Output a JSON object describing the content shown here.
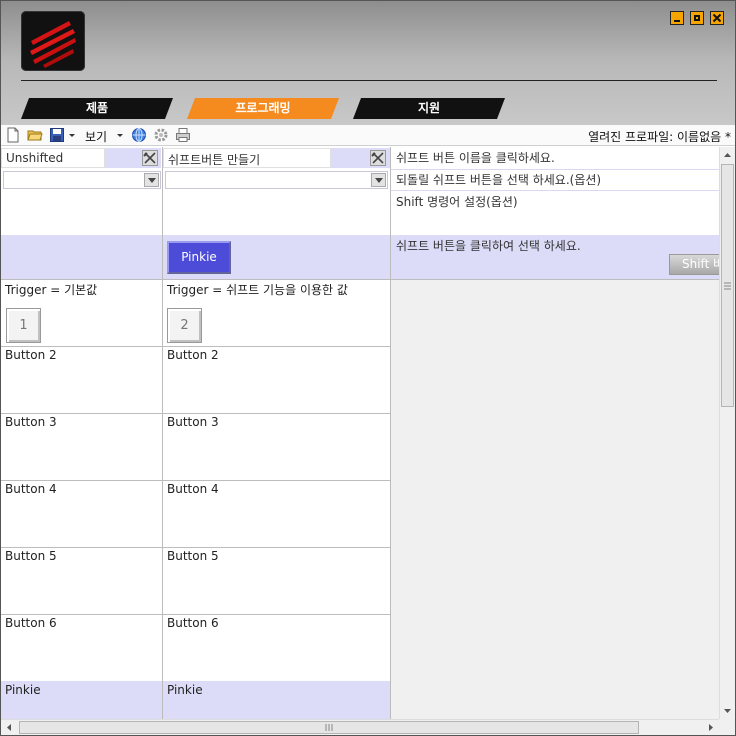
{
  "window": {
    "controls": [
      "minimize",
      "restore",
      "close"
    ]
  },
  "tabs": [
    {
      "label": "제품",
      "active": false
    },
    {
      "label": "프로그래밍",
      "active": true
    },
    {
      "label": "지원",
      "active": false
    }
  ],
  "toolbar": {
    "view_label": "보기",
    "profile_label": "열려진 프로파일: 이름없음 *"
  },
  "col1": {
    "header": "Unshifted",
    "rows": [
      "Trigger  = 기본값",
      "Button 2",
      "Button 3",
      "Button 4",
      "Button 5",
      "Button 6",
      "Pinkie"
    ],
    "button_number": "1"
  },
  "col2": {
    "header": "쉬프트버튼 만들기",
    "pinkie_button": "Pinkie",
    "rows": [
      "Trigger  = 쉬프트 기능을 이용한 값",
      "Button 2",
      "Button 3",
      "Button 4",
      "Button 5",
      "Button 6",
      "Pinkie"
    ],
    "button_number": "2"
  },
  "col3": {
    "instruction1": "쉬프트 버튼 이름을 클릭하세요.",
    "instruction2": "되돌릴 쉬프트 버튼을 선택 하세요.(옵션)",
    "instruction3": "Shift 명령어 설정(옵션)",
    "instruction4": "쉬프트 버튼을 클릭하여 선택 하세요.",
    "shift_button": "Shift 버"
  },
  "colors": {
    "accent": "#f58a1f",
    "band": "#dcdcf8",
    "pinkie_button": "#4c4cd8"
  }
}
